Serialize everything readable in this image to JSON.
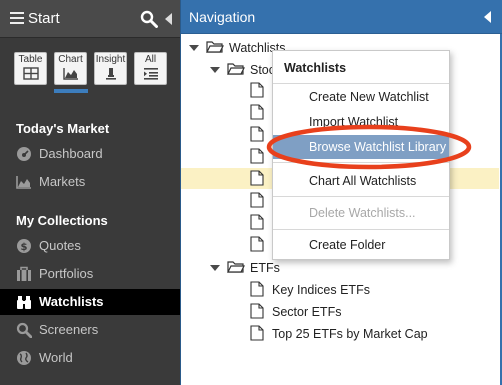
{
  "sidebar": {
    "title": "Start",
    "view_tabs": [
      {
        "label": "Table",
        "icon": "table-icon"
      },
      {
        "label": "Chart",
        "icon": "chart-icon"
      },
      {
        "label": "Insight",
        "icon": "insight-icon"
      },
      {
        "label": "All",
        "icon": "list-icon"
      }
    ],
    "active_view_tab": "Chart",
    "sections": [
      {
        "title": "Today's Market",
        "items": [
          {
            "label": "Dashboard",
            "icon": "dashboard-icon"
          },
          {
            "label": "Markets",
            "icon": "chart-area-icon"
          }
        ]
      },
      {
        "title": "My Collections",
        "items": [
          {
            "label": "Quotes",
            "icon": "dollar-icon"
          },
          {
            "label": "Portfolios",
            "icon": "briefcase-icon"
          },
          {
            "label": "Watchlists",
            "icon": "binoculars-icon",
            "active": true
          },
          {
            "label": "Screeners",
            "icon": "search-icon"
          },
          {
            "label": "World",
            "icon": "globe-icon"
          }
        ]
      }
    ]
  },
  "navigation": {
    "title": "Navigation",
    "tree": {
      "root": "Watchlists",
      "stocks_folder_partial": "Stoc",
      "etfs_folder": "ETFs",
      "etf_items": [
        "Key Indices ETFs",
        "Sector ETFs",
        "Top 25 ETFs by Market Cap"
      ]
    }
  },
  "context_menu": {
    "title": "Watchlists",
    "items": [
      {
        "label": "Create New Watchlist",
        "state": "normal"
      },
      {
        "label": "Import Watchlist",
        "state": "normal"
      },
      {
        "label": "Browse Watchlist Library",
        "state": "selected"
      },
      {
        "label": "Chart All Watchlists",
        "state": "normal"
      },
      {
        "label": "Delete Watchlists...",
        "state": "disabled"
      },
      {
        "label": "Create Folder",
        "state": "normal"
      }
    ]
  },
  "colors": {
    "sidebar_bg": "#3a3a3a",
    "header_blue": "#3571ad",
    "menu_selected": "#7f9fc4",
    "highlight_oval": "#e8401c",
    "row_highlight": "#fbf1c4"
  }
}
